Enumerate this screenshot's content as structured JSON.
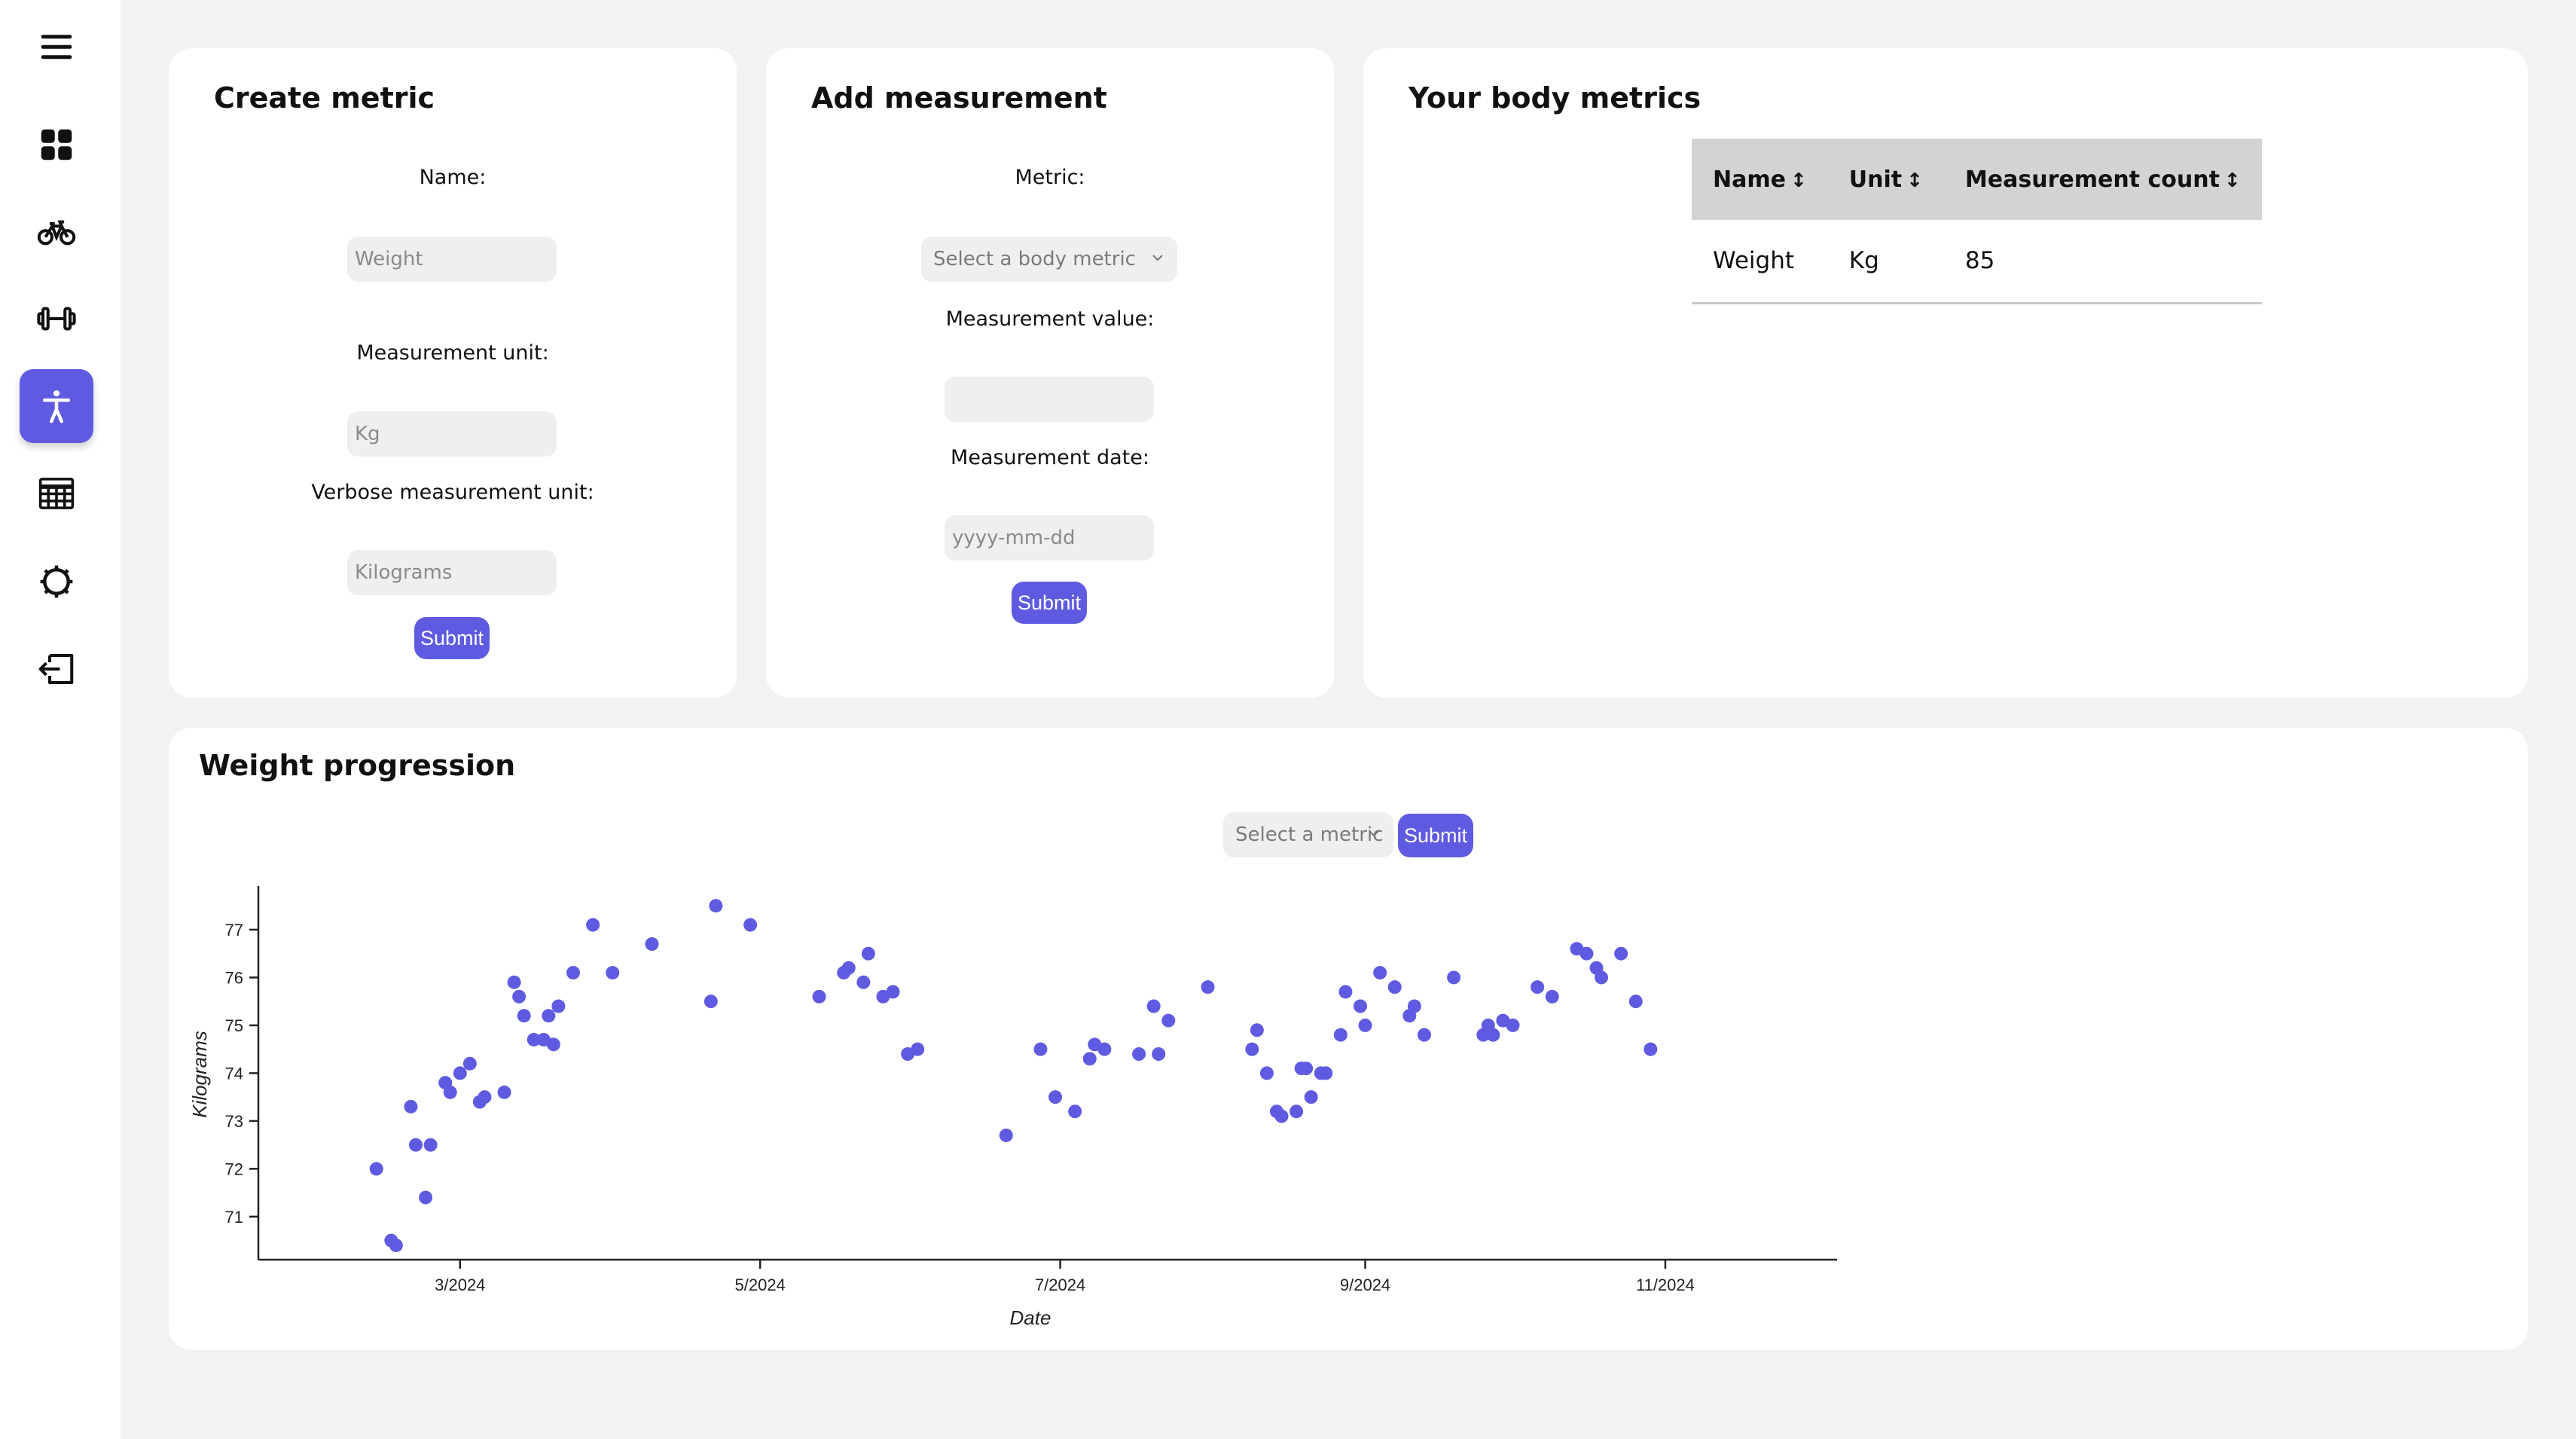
{
  "sidebar": {
    "items": [
      {
        "icon": "menu-icon"
      },
      {
        "icon": "dashboard-icon"
      },
      {
        "icon": "bicycle-icon"
      },
      {
        "icon": "dumbbell-icon"
      },
      {
        "icon": "accessibility-icon",
        "active": true
      },
      {
        "icon": "table-icon"
      },
      {
        "icon": "gear-icon"
      },
      {
        "icon": "logout-icon"
      }
    ],
    "accent": "#5f5be0"
  },
  "create_metric": {
    "title": "Create metric",
    "name_label": "Name:",
    "name_placeholder": "Weight",
    "unit_label": "Measurement unit:",
    "unit_placeholder": "Kg",
    "verbose_label": "Verbose measurement unit:",
    "verbose_placeholder": "Kilograms",
    "submit": "Submit"
  },
  "add_measurement": {
    "title": "Add measurement",
    "metric_label": "Metric:",
    "metric_select": "Select a body metric",
    "value_label": "Measurement value:",
    "value_placeholder": "",
    "date_label": "Measurement date:",
    "date_placeholder": "yyyy-mm-dd",
    "submit": "Submit"
  },
  "body_metrics": {
    "title": "Your body metrics",
    "columns": [
      "Name",
      "Unit",
      "Measurement count"
    ],
    "rows": [
      [
        "Weight",
        "Kg",
        "85"
      ]
    ]
  },
  "progression": {
    "title": "Weight progression",
    "metric_select": "Select a metric",
    "submit": "Submit"
  },
  "chart_data": {
    "type": "scatter",
    "xlabel": "Date",
    "ylabel": "Kilograms",
    "x_ticks": [
      "3/2024",
      "5/2024",
      "7/2024",
      "9/2024",
      "11/2024"
    ],
    "y_ticks": [
      71,
      72,
      73,
      74,
      75,
      76,
      77
    ],
    "x_range": [
      "2024-01-20",
      "2024-12-05"
    ],
    "ylim": [
      70.1,
      77.85
    ],
    "color": "#5f5be0",
    "points": [
      {
        "x": "2024-02-13",
        "y": 72.0
      },
      {
        "x": "2024-02-16",
        "y": 70.5
      },
      {
        "x": "2024-02-17",
        "y": 70.4
      },
      {
        "x": "2024-02-20",
        "y": 73.3
      },
      {
        "x": "2024-02-21",
        "y": 72.5
      },
      {
        "x": "2024-02-23",
        "y": 71.4
      },
      {
        "x": "2024-02-24",
        "y": 72.5
      },
      {
        "x": "2024-02-27",
        "y": 73.8
      },
      {
        "x": "2024-02-28",
        "y": 73.6
      },
      {
        "x": "2024-03-01",
        "y": 74.0
      },
      {
        "x": "2024-03-03",
        "y": 74.2
      },
      {
        "x": "2024-03-05",
        "y": 73.4
      },
      {
        "x": "2024-03-06",
        "y": 73.5
      },
      {
        "x": "2024-03-10",
        "y": 73.6
      },
      {
        "x": "2024-03-12",
        "y": 75.9
      },
      {
        "x": "2024-03-13",
        "y": 75.6
      },
      {
        "x": "2024-03-14",
        "y": 75.2
      },
      {
        "x": "2024-03-16",
        "y": 74.7
      },
      {
        "x": "2024-03-18",
        "y": 74.7
      },
      {
        "x": "2024-03-19",
        "y": 75.2
      },
      {
        "x": "2024-03-20",
        "y": 74.6
      },
      {
        "x": "2024-03-21",
        "y": 75.4
      },
      {
        "x": "2024-03-24",
        "y": 76.1
      },
      {
        "x": "2024-03-28",
        "y": 77.1
      },
      {
        "x": "2024-04-01",
        "y": 76.1
      },
      {
        "x": "2024-04-09",
        "y": 76.7
      },
      {
        "x": "2024-04-21",
        "y": 75.5
      },
      {
        "x": "2024-04-22",
        "y": 77.5
      },
      {
        "x": "2024-04-29",
        "y": 77.1
      },
      {
        "x": "2024-05-13",
        "y": 75.6
      },
      {
        "x": "2024-05-18",
        "y": 76.1
      },
      {
        "x": "2024-05-19",
        "y": 76.2
      },
      {
        "x": "2024-05-22",
        "y": 75.9
      },
      {
        "x": "2024-05-23",
        "y": 76.5
      },
      {
        "x": "2024-05-26",
        "y": 75.6
      },
      {
        "x": "2024-05-28",
        "y": 75.7
      },
      {
        "x": "2024-05-31",
        "y": 74.4
      },
      {
        "x": "2024-06-02",
        "y": 74.5
      },
      {
        "x": "2024-06-20",
        "y": 72.7
      },
      {
        "x": "2024-06-27",
        "y": 74.5
      },
      {
        "x": "2024-06-30",
        "y": 73.5
      },
      {
        "x": "2024-07-04",
        "y": 73.2
      },
      {
        "x": "2024-07-07",
        "y": 74.3
      },
      {
        "x": "2024-07-08",
        "y": 74.6
      },
      {
        "x": "2024-07-10",
        "y": 74.5
      },
      {
        "x": "2024-07-17",
        "y": 74.4
      },
      {
        "x": "2024-07-20",
        "y": 75.4
      },
      {
        "x": "2024-07-21",
        "y": 74.4
      },
      {
        "x": "2024-07-23",
        "y": 75.1
      },
      {
        "x": "2024-07-31",
        "y": 75.8
      },
      {
        "x": "2024-08-09",
        "y": 74.5
      },
      {
        "x": "2024-08-10",
        "y": 74.9
      },
      {
        "x": "2024-08-12",
        "y": 74.0
      },
      {
        "x": "2024-08-14",
        "y": 73.2
      },
      {
        "x": "2024-08-15",
        "y": 73.1
      },
      {
        "x": "2024-08-18",
        "y": 73.2
      },
      {
        "x": "2024-08-19",
        "y": 74.1
      },
      {
        "x": "2024-08-20",
        "y": 74.1
      },
      {
        "x": "2024-08-21",
        "y": 73.5
      },
      {
        "x": "2024-08-23",
        "y": 74.0
      },
      {
        "x": "2024-08-24",
        "y": 74.0
      },
      {
        "x": "2024-08-27",
        "y": 74.8
      },
      {
        "x": "2024-08-28",
        "y": 75.7
      },
      {
        "x": "2024-08-31",
        "y": 75.4
      },
      {
        "x": "2024-09-01",
        "y": 75.0
      },
      {
        "x": "2024-09-04",
        "y": 76.1
      },
      {
        "x": "2024-09-07",
        "y": 75.8
      },
      {
        "x": "2024-09-10",
        "y": 75.2
      },
      {
        "x": "2024-09-11",
        "y": 75.4
      },
      {
        "x": "2024-09-13",
        "y": 74.8
      },
      {
        "x": "2024-09-19",
        "y": 76.0
      },
      {
        "x": "2024-09-25",
        "y": 74.8
      },
      {
        "x": "2024-09-26",
        "y": 75.0
      },
      {
        "x": "2024-09-27",
        "y": 74.8
      },
      {
        "x": "2024-09-29",
        "y": 75.1
      },
      {
        "x": "2024-10-01",
        "y": 75.0
      },
      {
        "x": "2024-10-06",
        "y": 75.8
      },
      {
        "x": "2024-10-09",
        "y": 75.6
      },
      {
        "x": "2024-10-14",
        "y": 76.6
      },
      {
        "x": "2024-10-16",
        "y": 76.5
      },
      {
        "x": "2024-10-18",
        "y": 76.2
      },
      {
        "x": "2024-10-19",
        "y": 76.0
      },
      {
        "x": "2024-10-23",
        "y": 76.5
      },
      {
        "x": "2024-10-26",
        "y": 75.5
      },
      {
        "x": "2024-10-29",
        "y": 74.5
      }
    ]
  }
}
